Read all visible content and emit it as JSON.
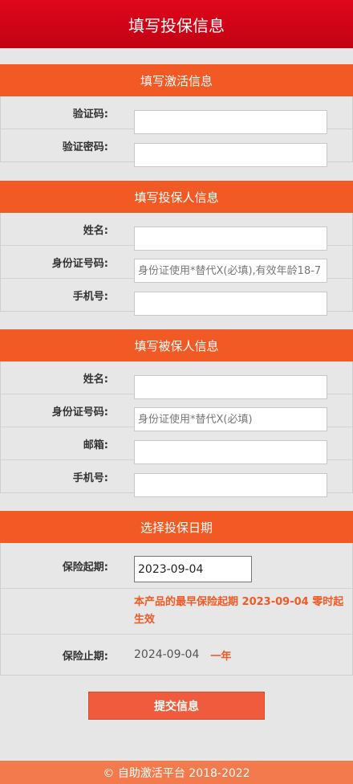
{
  "header": {
    "title": "填写投保信息"
  },
  "sections": {
    "activation": {
      "title": "填写激活信息",
      "code_label": "验证码:",
      "password_label": "验证密码:"
    },
    "applicant": {
      "title": "填写投保人信息",
      "name_label": "姓名:",
      "id_label": "身份证号码:",
      "id_placeholder": "身份证使用*替代X(必填),有效年龄18-7",
      "phone_label": "手机号:"
    },
    "insured": {
      "title": "填写被保人信息",
      "name_label": "姓名:",
      "id_label": "身份证号码:",
      "id_placeholder": "身份证使用*替代X(必填)",
      "email_label": "邮箱:",
      "phone_label": "手机号:"
    },
    "dates": {
      "title": "选择投保日期",
      "start_label": "保险起期:",
      "start_value": "2023-09-04",
      "note": "本产品的最早保险起期 2023-09-04 零时起生效",
      "end_label": "保险止期:",
      "end_value": "2024-09-04",
      "end_unit": "一年"
    }
  },
  "submit_label": "提交信息",
  "footer": {
    "text": "©  自助激活平台 2018-2022"
  }
}
